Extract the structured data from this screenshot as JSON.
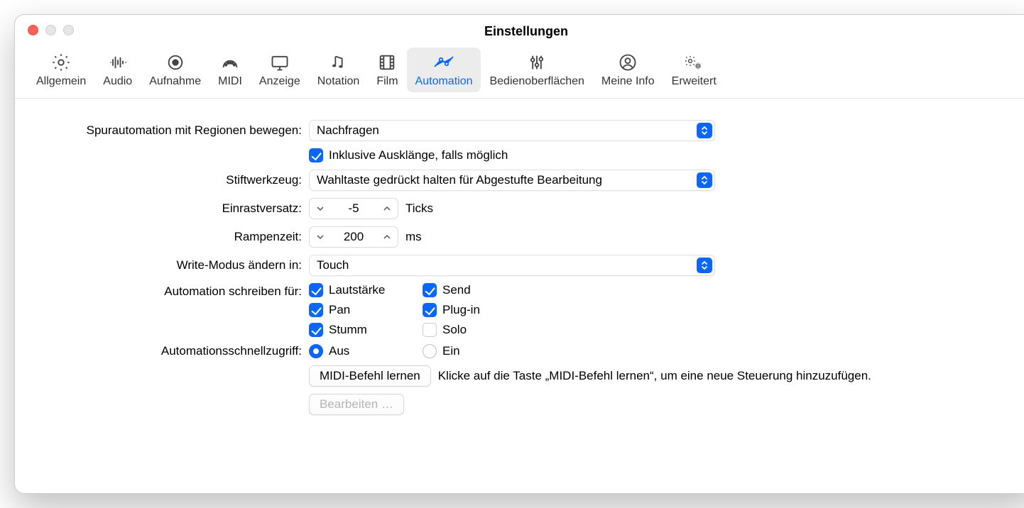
{
  "window": {
    "title": "Einstellungen"
  },
  "tabs": [
    {
      "id": "allgemein",
      "label": "Allgemein"
    },
    {
      "id": "audio",
      "label": "Audio"
    },
    {
      "id": "aufnahme",
      "label": "Aufnahme"
    },
    {
      "id": "midi",
      "label": "MIDI"
    },
    {
      "id": "anzeige",
      "label": "Anzeige"
    },
    {
      "id": "notation",
      "label": "Notation"
    },
    {
      "id": "film",
      "label": "Film"
    },
    {
      "id": "automation",
      "label": "Automation",
      "active": true
    },
    {
      "id": "bedienober",
      "label": "Bedienoberflächen"
    },
    {
      "id": "meineinfo",
      "label": "Meine Info"
    },
    {
      "id": "erweitert",
      "label": "Erweitert"
    }
  ],
  "form": {
    "moveTrackAutomation": {
      "label": "Spurautomation mit Regionen bewegen:",
      "value": "Nachfragen"
    },
    "includeOverhang": {
      "label": "Inklusive Ausklänge, falls möglich",
      "checked": true
    },
    "pencilTool": {
      "label": "Stiftwerkzeug:",
      "value": "Wahltaste gedrückt halten für Abgestufte Bearbeitung"
    },
    "snapOffset": {
      "label": "Einrastversatz:",
      "value": "-5",
      "unit": "Ticks"
    },
    "rampTime": {
      "label": "Rampenzeit:",
      "value": "200",
      "unit": "ms"
    },
    "writeModeChange": {
      "label": "Write-Modus ändern in:",
      "value": "Touch"
    },
    "writeAutomationFor": {
      "label": "Automation schreiben für:",
      "items": [
        {
          "id": "volume",
          "label": "Lautstärke",
          "checked": true
        },
        {
          "id": "send",
          "label": "Send",
          "checked": true
        },
        {
          "id": "pan",
          "label": "Pan",
          "checked": true
        },
        {
          "id": "plugin",
          "label": "Plug-in",
          "checked": true
        },
        {
          "id": "mute",
          "label": "Stumm",
          "checked": true
        },
        {
          "id": "solo",
          "label": "Solo",
          "checked": false
        }
      ]
    },
    "quickAccess": {
      "label": "Automationsschnellzugriff:",
      "options": [
        {
          "id": "off",
          "label": "Aus",
          "checked": true
        },
        {
          "id": "on",
          "label": "Ein",
          "checked": false
        }
      ]
    },
    "learnButton": "MIDI-Befehl lernen",
    "learnHint": "Klicke auf die Taste „MIDI-Befehl lernen“, um eine neue Steuerung hinzuzufügen.",
    "editButton": "Bearbeiten …"
  }
}
